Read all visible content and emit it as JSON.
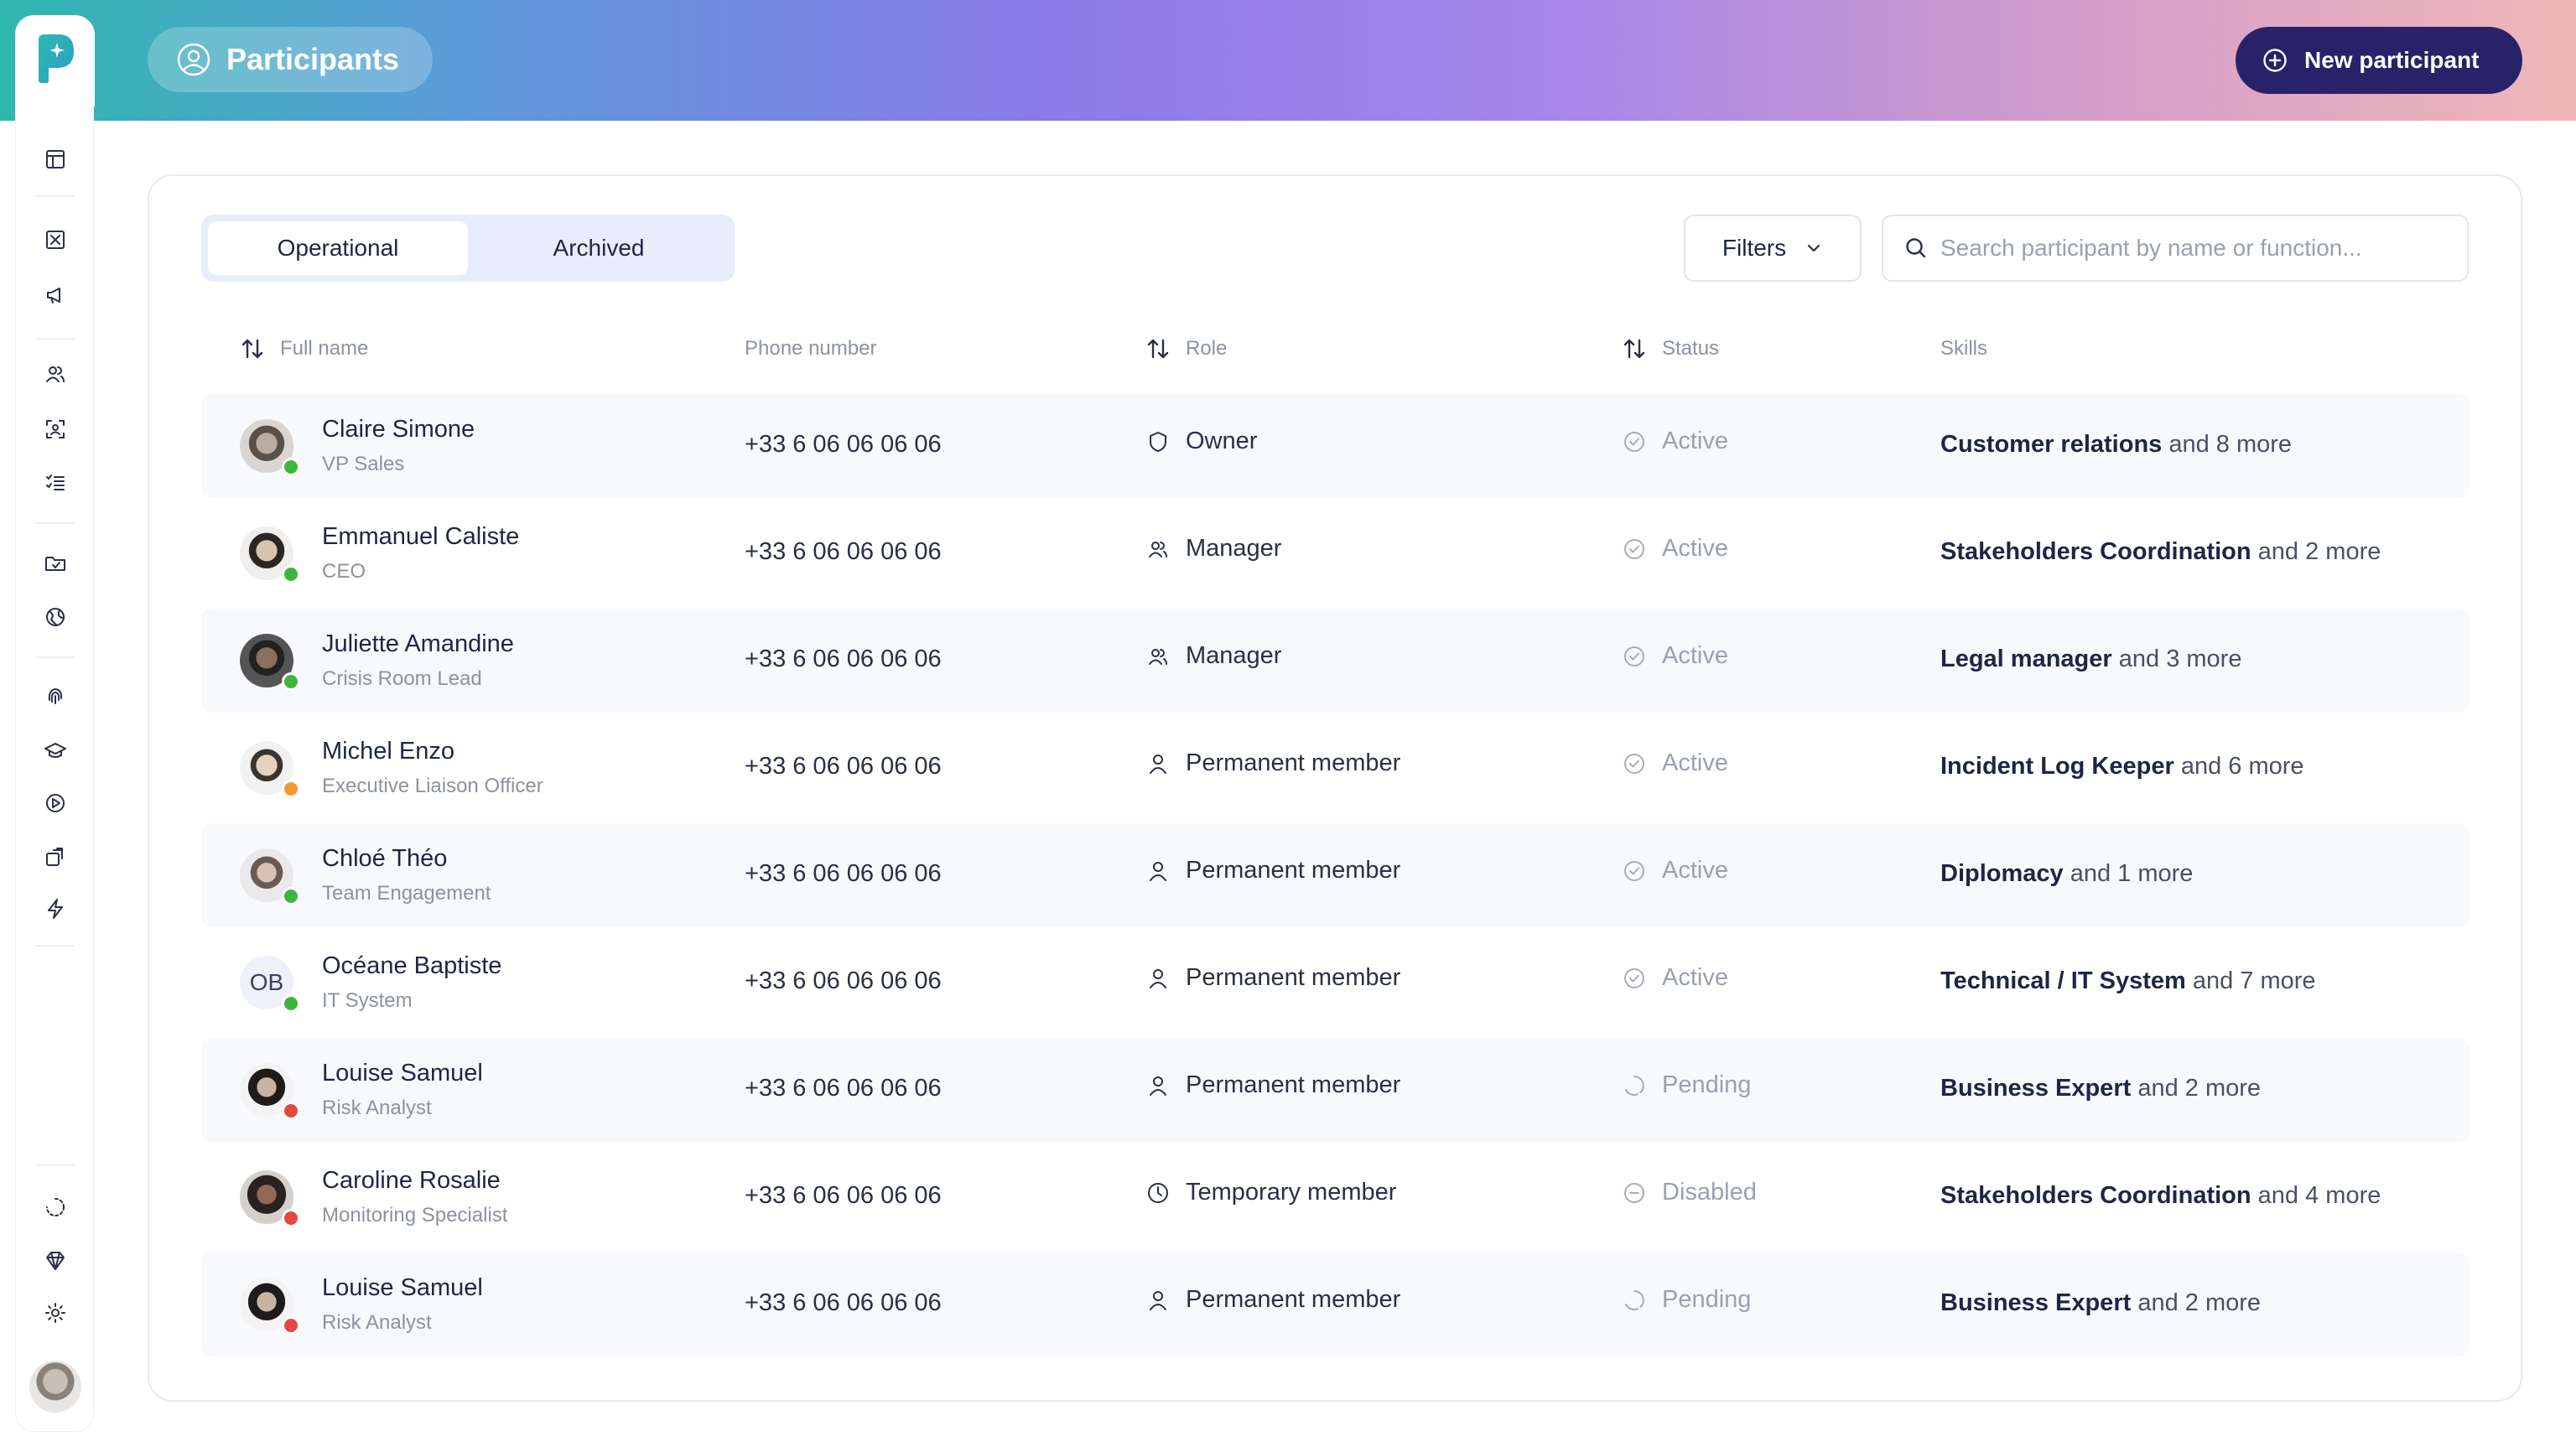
{
  "header": {
    "title": "Participants",
    "new_button_label": "New participant"
  },
  "colors": {
    "brand_dark": "#28226a",
    "online": "#3fb53f",
    "away": "#f29a2e",
    "offline": "#e5463f"
  },
  "sidebar": {
    "icons": [
      "dashboard-icon",
      "incident-icon",
      "megaphone-icon",
      "users-icon",
      "scan-face-icon",
      "checklist-icon",
      "folder-icon",
      "globe-icon",
      "fingerprint-icon",
      "graduation-cap-icon",
      "play-icon",
      "share-icon",
      "lightning-icon",
      "loader-icon",
      "diamond-icon",
      "settings-icon"
    ]
  },
  "tabs": [
    {
      "label": "Operational",
      "active": true
    },
    {
      "label": "Archived",
      "active": false
    }
  ],
  "filters": {
    "label": "Filters"
  },
  "search": {
    "placeholder": "Search participant by name or function..."
  },
  "columns": {
    "full_name": "Full name",
    "phone": "Phone number",
    "role": "Role",
    "status": "Status",
    "skills": "Skills"
  },
  "rows": [
    {
      "name": "Claire Simone",
      "function": "VP Sales",
      "phone": "+33 6 06 06 06 06",
      "role": "Owner",
      "role_icon": "shield-icon",
      "status": "Active",
      "presence": "online",
      "skill": "Customer relations",
      "more": "and 8 more"
    },
    {
      "name": "Emmanuel Caliste",
      "function": "CEO",
      "phone": "+33 6 06 06 06 06",
      "role": "Manager",
      "role_icon": "users-icon",
      "status": "Active",
      "presence": "online",
      "skill": "Stakeholders Coordination",
      "more": "and 2 more"
    },
    {
      "name": "Juliette Amandine",
      "function": "Crisis Room Lead",
      "phone": "+33 6 06 06 06 06",
      "role": "Manager",
      "role_icon": "users-icon",
      "status": "Active",
      "presence": "online",
      "skill": "Legal manager",
      "more": "and 3 more"
    },
    {
      "name": "Michel Enzo",
      "function": "Executive Liaison Officer",
      "phone": "+33 6 06 06 06 06",
      "role": "Permanent member",
      "role_icon": "user-icon",
      "status": "Active",
      "presence": "away",
      "skill": "Incident Log Keeper",
      "more": "and 6 more"
    },
    {
      "name": "Chloé Théo",
      "function": "Team Engagement",
      "phone": "+33 6 06 06 06 06",
      "role": "Permanent member",
      "role_icon": "user-icon",
      "status": "Active",
      "presence": "online",
      "skill": "Diplomacy",
      "more": "and 1 more"
    },
    {
      "name": "Océane Baptiste",
      "function": "IT System",
      "initials": "OB",
      "phone": "+33 6 06 06 06 06",
      "role": "Permanent member",
      "role_icon": "user-icon",
      "status": "Active",
      "presence": "online",
      "skill": "Technical / IT System",
      "more": "and 7 more"
    },
    {
      "name": "Louise Samuel",
      "function": "Risk Analyst",
      "phone": "+33 6 06 06 06 06",
      "role": "Permanent member",
      "role_icon": "user-icon",
      "status": "Pending",
      "presence": "offline",
      "skill": "Business Expert",
      "more": "and 2 more"
    },
    {
      "name": "Caroline Rosalie",
      "function": "Monitoring Specialist",
      "phone": "+33 6 06 06 06 06",
      "role": "Temporary member",
      "role_icon": "clock-icon",
      "status": "Disabled",
      "presence": "offline",
      "skill": "Stakeholders Coordination",
      "more": "and 4 more"
    },
    {
      "name": "Louise Samuel",
      "function": "Risk Analyst",
      "phone": "+33 6 06 06 06 06",
      "role": "Permanent member",
      "role_icon": "user-icon",
      "status": "Pending",
      "presence": "offline",
      "skill": "Business Expert",
      "more": "and 2 more"
    }
  ]
}
